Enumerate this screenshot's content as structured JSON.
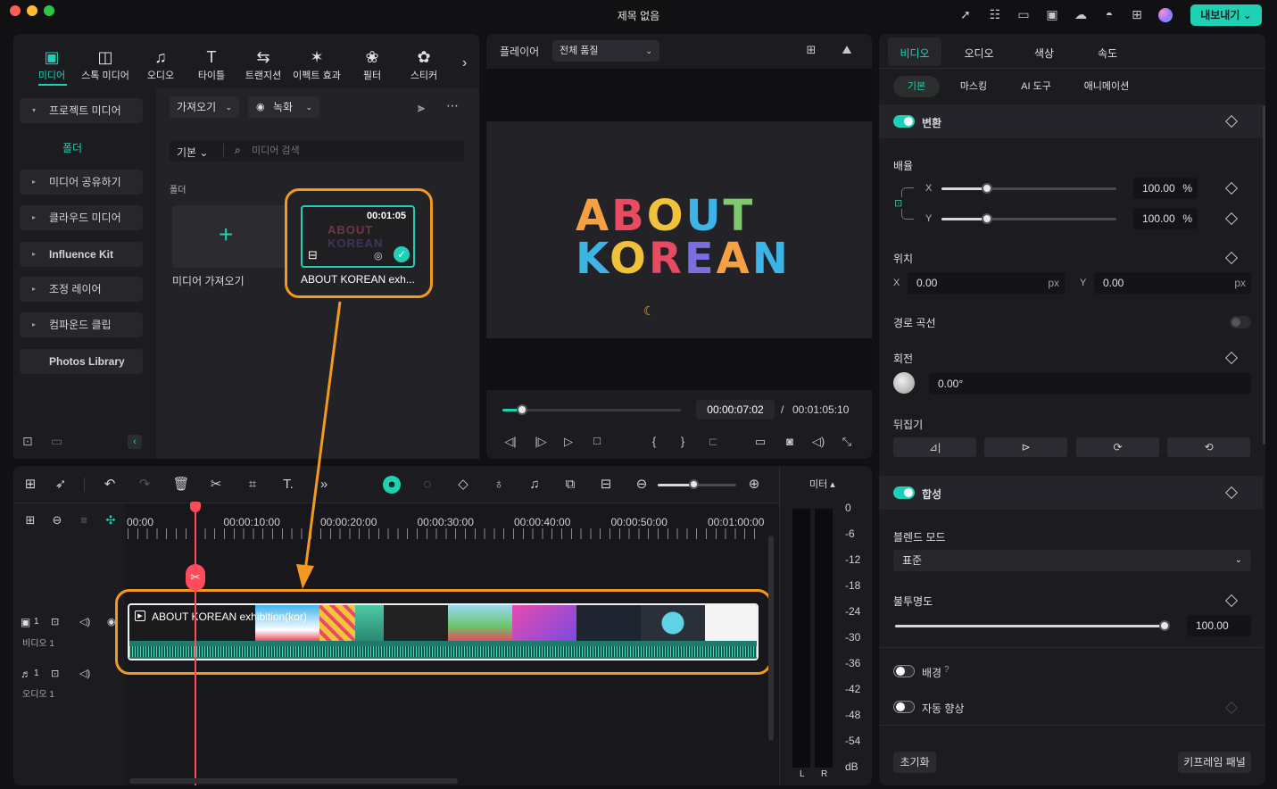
{
  "window": {
    "title": "제목 없음",
    "export_label": "내보내기"
  },
  "media_tabs": [
    {
      "label": "미디어",
      "icon": "media-icon"
    },
    {
      "label": "스톡 미디어",
      "icon": "stock-media-icon"
    },
    {
      "label": "오디오",
      "icon": "music-note-icon"
    },
    {
      "label": "타이틀",
      "icon": "title-t-icon"
    },
    {
      "label": "트랜지션",
      "icon": "transition-icon"
    },
    {
      "label": "이펙트 효과",
      "icon": "effects-star-icon"
    },
    {
      "label": "필터",
      "icon": "filter-icon"
    },
    {
      "label": "스티커",
      "icon": "sticker-icon"
    }
  ],
  "sidebar": {
    "items": [
      {
        "label": "프로젝트 미디어",
        "caret": "▾"
      },
      {
        "label": "폴더"
      },
      {
        "label": "미디어 공유하기",
        "caret": "▸"
      },
      {
        "label": "클라우드 미디어",
        "caret": "▸"
      },
      {
        "label": "Influence Kit",
        "caret": "▸"
      },
      {
        "label": "조정 레이어",
        "caret": "▸"
      },
      {
        "label": "컴파운드 클립",
        "caret": "▸"
      },
      {
        "label": "Photos Library"
      }
    ]
  },
  "media": {
    "import_label": "가져오기",
    "record_label": "녹화",
    "sort_label": "기본",
    "search_placeholder": "미디어 검색",
    "folder_label": "폴더",
    "import_media_label": "미디어 가져오기",
    "clip_duration": "00:01:05",
    "clip_name": "ABOUT KOREAN exh...",
    "thumb_text_1": "ABOUT",
    "thumb_text_2": "KOREAN"
  },
  "player": {
    "label": "플레이어",
    "quality": "전체 품질",
    "title_line1": "ABOUT",
    "title_line2": "KOREAN",
    "current_time": "00:00:07:02",
    "separator": "/",
    "total_time": "00:01:05:10",
    "progress": 0.11,
    "brace_open": "{",
    "brace_close": "}"
  },
  "timeline": {
    "ruler": [
      "00:00",
      "00:00:10:00",
      "00:00:20:00",
      "00:00:30:00",
      "00:00:40:00",
      "00:00:50:00",
      "00:01:00:00"
    ],
    "clip_title": "ABOUT KOREAN exhibition(kor)",
    "video_track": {
      "number": "1",
      "label": "비디오 1"
    },
    "audio_track": {
      "number": "1",
      "label": "오디오 1"
    },
    "meter_label": "미터",
    "meter_ticks": [
      "0",
      "-6",
      "-12",
      "-18",
      "-24",
      "-30",
      "-36",
      "-42",
      "-48",
      "-54",
      "dB"
    ],
    "meter_l": "L",
    "meter_r": "R",
    "zoom_level": 0.45
  },
  "properties": {
    "tabs": [
      "비디오",
      "오디오",
      "색상",
      "속도"
    ],
    "subtabs": [
      "기본",
      "마스킹",
      "AI 도구",
      "애니메이션"
    ],
    "transform_label": "변환",
    "scale_label": "배율",
    "scale_x_axis": "X",
    "scale_y_axis": "Y",
    "scale_x": "100.00",
    "scale_y": "100.00",
    "percent": "%",
    "position_label": "위치",
    "pos_x_axis": "X",
    "pos_y_axis": "Y",
    "pos_x": "0.00",
    "pos_y": "0.00",
    "px": "px",
    "path_curve_label": "경로 곡선",
    "rotation_label": "회전",
    "rotation_value": "0.00°",
    "flip_label": "뒤집기",
    "composite_label": "합성",
    "blend_mode_label": "블렌드 모드",
    "blend_mode_value": "표준",
    "opacity_label": "불투명도",
    "opacity_value": "100.00",
    "background_label": "배경",
    "auto_enhance_label": "자동 향상",
    "reset_label": "초기화",
    "keyframe_panel_label": "키프레임 패널"
  },
  "colors": {
    "accent": "#1fd1b4",
    "playhead": "#ff4b5c",
    "highlight": "#f39a1e"
  }
}
